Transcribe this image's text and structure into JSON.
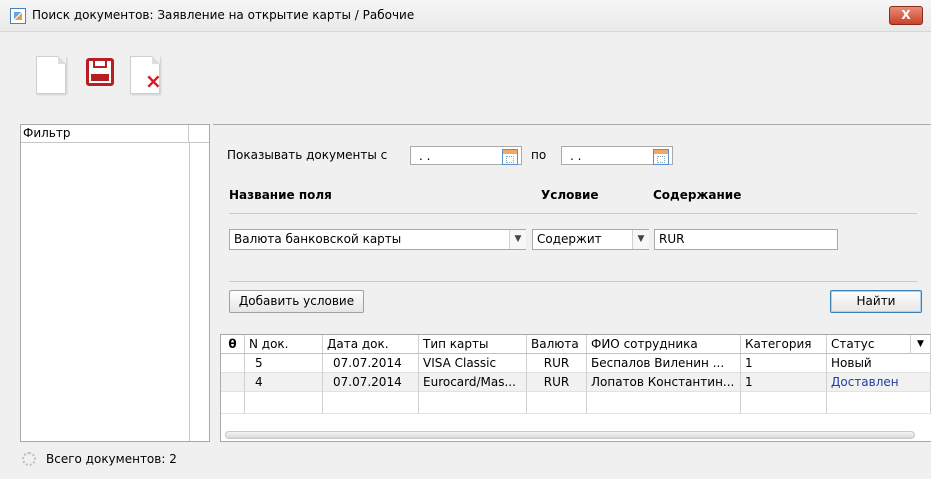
{
  "window": {
    "title": "Поиск документов: Заявление на открытие карты / Рабочие",
    "close_label": "X"
  },
  "toolbar": {
    "icons": [
      "new-document-icon",
      "save-icon",
      "delete-icon"
    ]
  },
  "filter": {
    "header": "Фильтр"
  },
  "search": {
    "show_docs_from_label": "Показывать документы с",
    "date_from_value": " .  .",
    "to_label": "по",
    "date_to_value": " .  .",
    "field_name_header": "Название поля",
    "condition_header": "Условие",
    "content_header": "Содержание",
    "field_value": "Валюта банковской карты",
    "condition_value": "Содержит",
    "content_value": "RUR",
    "add_condition_label": "Добавить условие",
    "find_label": "Найти"
  },
  "grid": {
    "columns": [
      "N док.",
      "Дата док.",
      "Тип карты",
      "Валюта",
      "ФИО сотрудника",
      "Категория",
      "Статус"
    ],
    "rows": [
      [
        "5",
        "07.07.2014",
        "VISA Classic",
        "RUR",
        "Беспалов Виленин ...",
        "1",
        "Новый"
      ],
      [
        "4",
        "07.07.2014",
        "Eurocard/Mas...",
        "RUR",
        "Лопатов Константин...",
        "1",
        "Доставлен"
      ]
    ],
    "status_colors": {
      "Новый": "#000000",
      "Доставлен": "#1f3fa0"
    }
  },
  "status_bar": {
    "total_label": "Всего документов: 2"
  }
}
